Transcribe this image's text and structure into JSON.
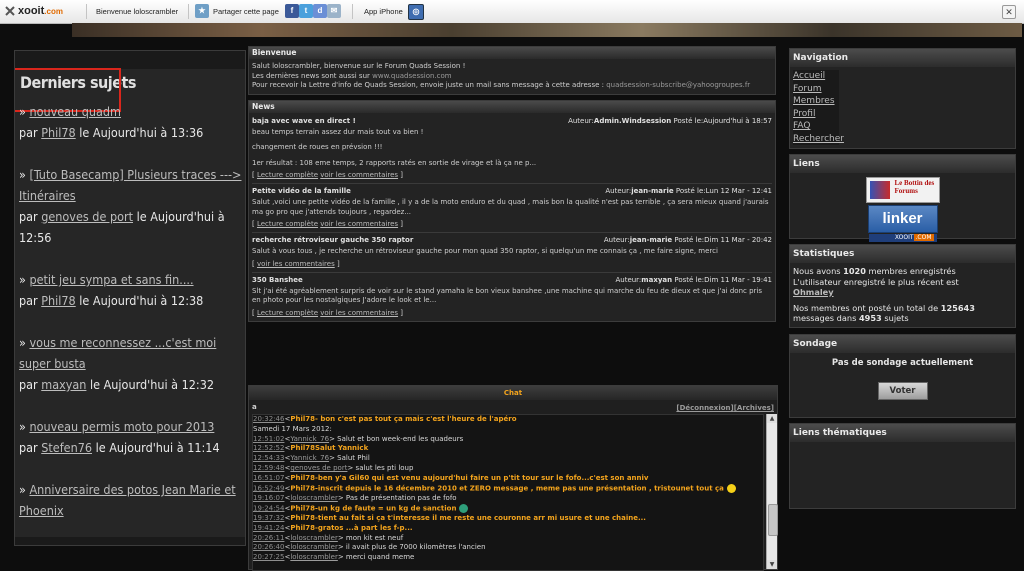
{
  "toolbar": {
    "logo": "xooit",
    "logo_suffix": ".com",
    "welcome": "Bienvenue loloscrambler",
    "share": "Partager cette page",
    "app": "App iPhone"
  },
  "left": {
    "title": "Derniers sujets",
    "topics": [
      {
        "title": "nouveau quadm",
        "by": "par",
        "user": "Phil78",
        "when": "le Aujourd'hui à 13:36"
      },
      {
        "title": "[Tuto Basecamp] Plusieurs traces ---> Itinéraires",
        "by": "par",
        "user": "genoves de port",
        "when": "le Aujourd'hui à 12:56"
      },
      {
        "title": "petit jeu sympa et sans fin....",
        "by": "par",
        "user": "Phil78",
        "when": "le Aujourd'hui à 12:38"
      },
      {
        "title": "vous me reconnessez ...c'est moi super busta",
        "by": "par",
        "user": "maxyan",
        "when": "le Aujourd'hui à 12:32"
      },
      {
        "title": "nouveau permis moto pour 2013",
        "by": "par",
        "user": "Stefen76",
        "when": "le Aujourd'hui à 11:14"
      },
      {
        "title": "Anniversaire des potos Jean Marie et Phoenix",
        "by": "",
        "user": "",
        "when": ""
      }
    ]
  },
  "welcome": {
    "title": "Bienvenue",
    "line1": "Salut loloscrambler, bienvenue sur le Forum Quads Session !",
    "line2_prefix": "Les dernières news sont aussi sur",
    "line2_link": "www.quadsession.com",
    "line3_prefix": "Pour recevoir la Lettre d'info de Quads Session, envoie juste un mail sans message à cette adresse :",
    "line3_link": "quadsession-subscribe@yahoogroupes.fr"
  },
  "news": {
    "title": "News",
    "read_more": "Lecture complète",
    "comments": "voir les commentaires",
    "items": [
      {
        "title": "baja avec wave en direct !",
        "author_label": "Auteur:",
        "author": "Admin.Windsession",
        "date": "Posté le:Aujourd'hui à 18:57",
        "body": [
          "beau temps terrain assez dur mais tout va bien !",
          "changement de roues en prévsion !!!",
          "1er résultat : 108 eme temps, 2 rapports ratés en sortie de virage et là ça ne p..."
        ],
        "full": true
      },
      {
        "title": "Petite vidéo de la famille",
        "author_label": "Auteur:",
        "author": "jean-marie",
        "date": "Posté le:Lun 12 Mar - 12:41",
        "body": [
          "Salut ,voici une petite vidéo de la famille , il y a de la moto enduro et du quad , mais bon la qualité n'est pas terrible , ça sera mieux quand j'aurais ma go pro que j'attends toujours , regardez..."
        ],
        "full": true
      },
      {
        "title": "recherche rétroviseur gauche 350 raptor",
        "author_label": "Auteur:",
        "author": "jean-marie",
        "date": "Posté le:Dim 11 Mar - 20:42",
        "body": [
          "Salut à vous tous , je recherche un rétroviseur gauche pour mon quad 350 raptor, si quelqu'un me connais ça , me faire signe, merci"
        ],
        "full": false
      },
      {
        "title": "350 Banshee",
        "author_label": "Auteur:",
        "author": "maxyan",
        "date": "Posté le:Dim 11 Mar - 19:41",
        "body": [
          "Slt j'ai été agréablement surpris de voir sur le stand yamaha le bon vieux banshee ,une machine qui marche du feu de dieux et que j'ai donc pris en photo pour les nostalgiques J'adore le look et le..."
        ],
        "full": true
      }
    ]
  },
  "chat": {
    "title": "Chat",
    "a": "a",
    "disconnect": "[Déconnexion]",
    "archives": "[Archives]",
    "lines": [
      {
        "time": "20:32:46",
        "user": "Phil78",
        "ucls": "uy",
        "msg": "- bon c'est pas tout ça mais c'est l'heure de l'apéro",
        "mcls": "my",
        "smile": ""
      },
      {
        "time": "",
        "user": "",
        "ucls": "",
        "msg": "Samedi 17 Mars 2012:",
        "mcls": "",
        "smile": ""
      },
      {
        "time": "12:51:02",
        "user": "Yannick_76",
        "ucls": "u",
        "msg": "> Salut et bon week-end les quadeurs",
        "mcls": "",
        "smile": ""
      },
      {
        "time": "12:52:52",
        "user": "Phil78",
        "ucls": "uy",
        "msg": "Salut Yannick",
        "mcls": "my",
        "smile": ""
      },
      {
        "time": "12:54:33",
        "user": "Yannick_76",
        "ucls": "u",
        "msg": "> Salut Phil",
        "mcls": "",
        "smile": ""
      },
      {
        "time": "12:59:48",
        "user": "genoves de port",
        "ucls": "u",
        "msg": "> salut les pti loup",
        "mcls": "",
        "smile": ""
      },
      {
        "time": "16:51:07",
        "user": "Phil78",
        "ucls": "uy",
        "msg": "-ben y'a Gil60 qui est venu aujourd'hui faire un p'tit tour sur le fofo...c'est son anniv",
        "mcls": "my",
        "smile": ""
      },
      {
        "time": "16:52:49",
        "user": "Phil78",
        "ucls": "uy",
        "msg": "-inscrit depuis le 16 décembre 2010 et ZERO message , meme pas une présentation , tristounet tout ça",
        "mcls": "my",
        "smile": "y"
      },
      {
        "time": "19:16:07",
        "user": "loloscrambler",
        "ucls": "u",
        "msg": "> Pas de présentation pas de fofo",
        "mcls": "",
        "smile": ""
      },
      {
        "time": "19:24:54",
        "user": "Phil78",
        "ucls": "uy",
        "msg": "-un kg de faute = un kg de sanction",
        "mcls": "my",
        "smile": "g"
      },
      {
        "time": "19:37:32",
        "user": "Phil78",
        "ucls": "uy",
        "msg": "-tient au fait si ça t'interesse il me reste une couronne arr mi usure et une chaine...",
        "mcls": "my",
        "smile": ""
      },
      {
        "time": "19:41:24",
        "user": "Phil78",
        "ucls": "uy",
        "msg": "-gratos ...à part les f-p...",
        "mcls": "my",
        "smile": ""
      },
      {
        "time": "20:26:11",
        "user": "loloscrambler",
        "ucls": "u",
        "msg": "> mon kit est neuf",
        "mcls": "",
        "smile": ""
      },
      {
        "time": "20:26:40",
        "user": "loloscrambler",
        "ucls": "u",
        "msg": "> il avait plus de 7000 kilomètres l'ancien",
        "mcls": "",
        "smile": ""
      },
      {
        "time": "20:27:25",
        "user": "loloscrambler",
        "ucls": "u",
        "msg": "> merci quand meme",
        "mcls": "",
        "smile": ""
      }
    ]
  },
  "nav": {
    "title": "Navigation",
    "items": [
      "Accueil",
      "Forum",
      "Membres",
      "Profil",
      "FAQ",
      "Rechercher"
    ]
  },
  "links": {
    "title": "Liens",
    "bottin_text": "Le Bottin des Forums",
    "linker_text": "linker",
    "xooit_text": "XOOIT",
    "xooit_suffix": ".COM"
  },
  "stats": {
    "title": "Statistiques",
    "line1_prefix": "Nous avons",
    "members_count": "1020",
    "line1_suffix": "membres enregistrés",
    "line2": "L'utilisateur enregistré le plus récent est",
    "latest_user": "Ohmaley",
    "line3_prefix": "Nos membres ont posté un total de",
    "messages_count": "125643",
    "line3_mid": "messages dans",
    "topics_count": "4953",
    "line3_suffix": "sujets"
  },
  "poll": {
    "title": "Sondage",
    "message": "Pas de sondage actuellement",
    "vote": "Voter"
  },
  "themes": {
    "title": "Liens thématiques"
  }
}
